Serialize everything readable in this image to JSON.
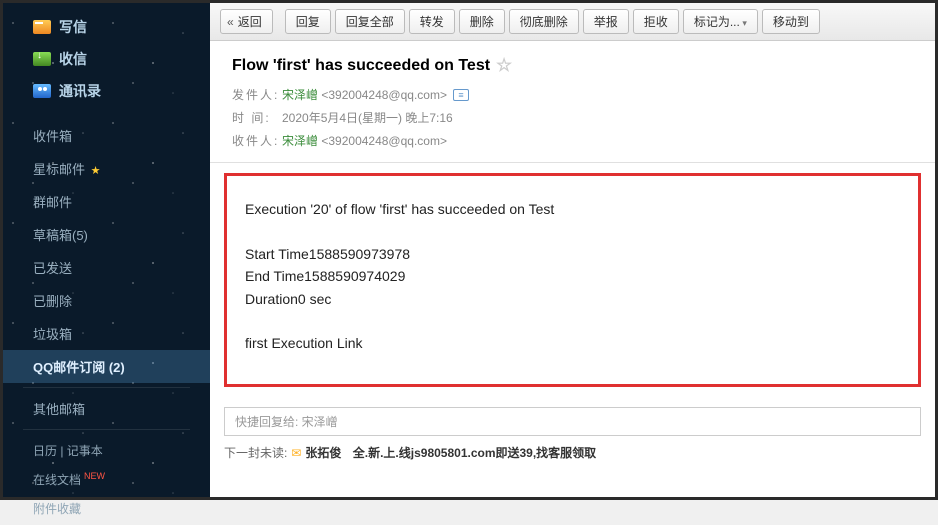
{
  "sidebar": {
    "top": [
      {
        "label": "写信",
        "icon": "icon-write"
      },
      {
        "label": "收信",
        "icon": "icon-receive"
      },
      {
        "label": "通讯录",
        "icon": "icon-contacts"
      }
    ],
    "folders": {
      "inbox": "收件箱",
      "starred": "星标邮件",
      "group": "群邮件",
      "drafts": "草稿箱(5)",
      "sent": "已发送",
      "deleted": "已删除",
      "trash": "垃圾箱",
      "subscription": "QQ邮件订阅 (2)",
      "other": "其他邮箱"
    },
    "bottom": {
      "calendar": "日历 | 记事本",
      "docs": "在线文档",
      "attachments": "附件收藏"
    }
  },
  "toolbar": {
    "back": "返回",
    "reply": "回复",
    "reply_all": "回复全部",
    "forward": "转发",
    "delete": "删除",
    "delete_perm": "彻底删除",
    "report": "举报",
    "reject": "拒收",
    "mark": "标记为...",
    "move": "移动到"
  },
  "mail": {
    "subject": "Flow 'first' has succeeded on Test",
    "from_label": "发件人:",
    "from_name": "宋泽嶒",
    "from_addr": "<392004248@qq.com>",
    "time_label": "时   间:",
    "time_value": "2020年5月4日(星期一) 晚上7:16",
    "to_label": "收件人:",
    "to_name": "宋泽嶒",
    "to_addr": "<392004248@qq.com>",
    "body": {
      "line1": "Execution '20' of flow 'first' has succeeded on Test",
      "line2": "Start Time1588590973978",
      "line3": "End Time1588590974029",
      "line4": "Duration0 sec",
      "line5": "first Execution Link"
    },
    "quick_reply_placeholder": "快捷回复给: 宋泽嶒",
    "next_unread_label": "下一封未读:",
    "next_unread_sender": "张拓俊",
    "next_unread_subject": "全.新.上.线js9805801.com即送39,找客服领取"
  }
}
